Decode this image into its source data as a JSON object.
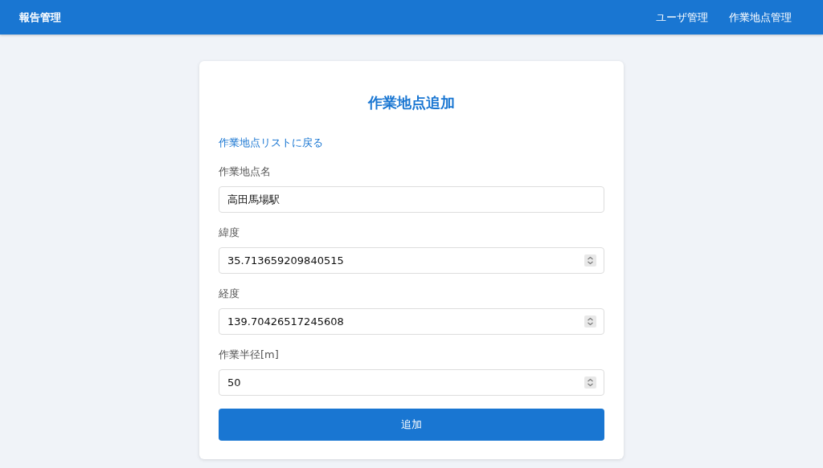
{
  "header": {
    "title": "報告管理",
    "nav": [
      {
        "label": "ユーザ管理"
      },
      {
        "label": "作業地点管理"
      }
    ]
  },
  "form": {
    "title": "作業地点追加",
    "back_link": "作業地点リストに戻る",
    "fields": [
      {
        "label": "作業地点名",
        "value": "高田馬場駅",
        "kind": "text"
      },
      {
        "label": "緯度",
        "value": "35.713659209840515",
        "kind": "number"
      },
      {
        "label": "経度",
        "value": "139.70426517245608",
        "kind": "number"
      },
      {
        "label": "作業半径[m]",
        "value": "50",
        "kind": "number"
      }
    ],
    "submit": "追加"
  }
}
